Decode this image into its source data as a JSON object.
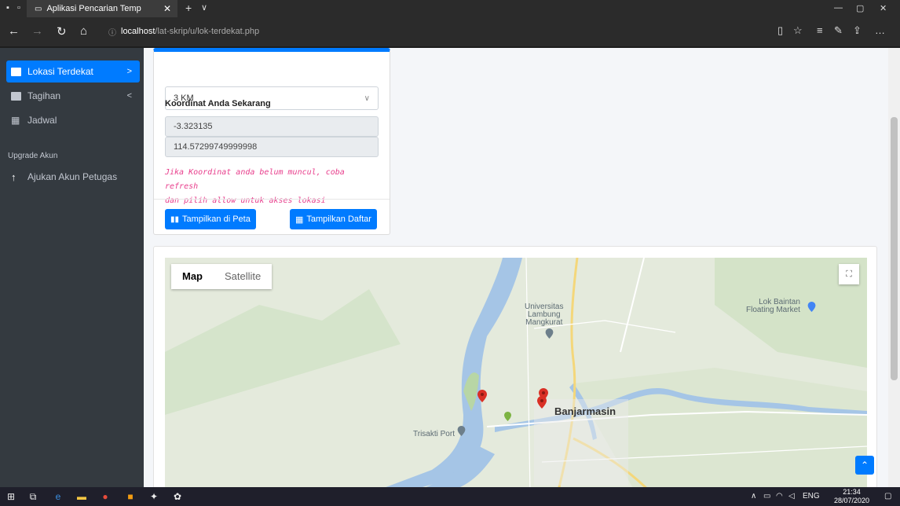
{
  "browser": {
    "tab_title": "Aplikasi Pencarian Temp",
    "tab_close": "✕",
    "new_tab": "+",
    "tab_dropdown": "∨",
    "url_host": "localhost",
    "url_path": "/lat-skrip/u/lok-terdekat.php",
    "win_minimize": "—",
    "win_restore": "▢",
    "win_close": "✕"
  },
  "sidebar": {
    "items": [
      {
        "label": "Lokasi Terdekat",
        "chevron": ">"
      },
      {
        "label": "Tagihan",
        "chevron": "<"
      },
      {
        "label": "Jadwal"
      }
    ],
    "section_header": "Upgrade Akun",
    "upgrade_item": {
      "label": "Ajukan Akun Petugas"
    }
  },
  "form": {
    "radius_value": "3 KM",
    "coordinates_label": "Koordinat Anda Sekarang",
    "latitude": "-3.323135",
    "longitude": "114.57299749999998",
    "hint_line1": "Jika Koordinat anda belum muncul, coba refresh",
    "hint_line2": "dan pilih allow untuk akses lokasi",
    "btn_map": "Tampilkan di Peta",
    "btn_list": "Tampilkan Daftar"
  },
  "map": {
    "type_map": "Map",
    "type_satellite": "Satellite",
    "labels": {
      "university": [
        "Universitas",
        "Lambung",
        "Mangkurat"
      ],
      "floating_market": [
        "Lok Baintan",
        "Floating Market"
      ],
      "city": "Banjarmasin",
      "port": "Trisakti Port"
    },
    "colors": {
      "water": "#a5c5e6",
      "land": "#dfe6d8",
      "pin": "#d93025",
      "pin_green": "#7cb342"
    }
  },
  "taskbar": {
    "lang": "ENG",
    "time": "21:34",
    "date": "28/07/2020"
  }
}
